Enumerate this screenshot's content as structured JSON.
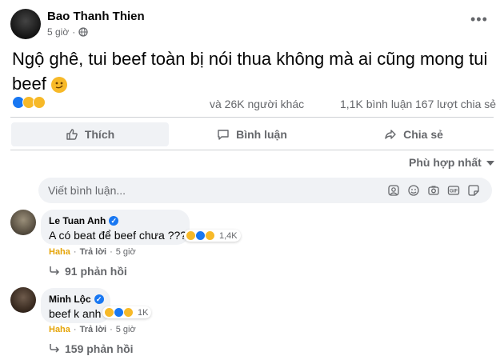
{
  "post": {
    "author": "Bao Thanh Thien",
    "time": "5 giờ",
    "text": "Ngộ ghê, tui beef toàn bị nói thua không mà ai cũng mong tui beef",
    "reactions_text": "và 26K người khác",
    "comments_count": "1,1K bình luận",
    "shares_count": "167 lượt chia sẻ",
    "icons": [
      "like-reaction",
      "haha-reaction",
      "sad-reaction",
      "smirk-emoji",
      "globe-icon",
      "more-icon"
    ]
  },
  "actions": {
    "like": "Thích",
    "comment": "Bình luận",
    "share": "Chia sẻ"
  },
  "sort": {
    "label": "Phù hợp nhất"
  },
  "comment_input": {
    "placeholder": "Viết bình luận..."
  },
  "comments": [
    {
      "author": "Le Tuan Anh",
      "text": "A có beat để beef chưa ???",
      "reactions_count": "1,4K",
      "reaction_label": "Haha",
      "reply_label": "Trả lời",
      "time": "5 giờ",
      "replies": "91 phản hồi"
    },
    {
      "author": "Minh Lộc",
      "text": "beef k anh",
      "reactions_count": "1K",
      "reaction_label": "Haha",
      "reply_label": "Trả lời",
      "time": "5 giờ",
      "replies": "159 phản hồi"
    }
  ],
  "colors": {
    "brand_blue": "#1877f2",
    "haha_yellow": "#f7b928",
    "muted_text": "#65676b",
    "bubble_bg": "#f0f2f5"
  }
}
